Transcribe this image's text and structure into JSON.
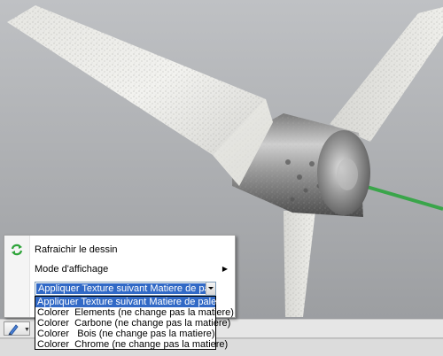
{
  "context_menu": {
    "refresh_label": "Rafraichir le dessin",
    "display_mode_label": "Mode d'affichage",
    "submenu_arrow": "▶"
  },
  "texture_select": {
    "selected": "Appliquer Texture suivant Matiere de pale",
    "options": [
      "Appliquer Texture suivant Matiere de pale",
      "Colorer  Elements (ne change pas la matiere)",
      "Colorer  Carbone (ne change pas la matiere)",
      "Colorer   Bois (ne change pas la matiere)",
      "Colorer  Chrome (ne change pas la matiere)"
    ],
    "highlighted_index": 0
  },
  "icons": {
    "refresh": "refresh-arrows-icon",
    "toolbar_tool": "pencil-icon",
    "dropdown": "chevron-down-icon"
  },
  "colors": {
    "highlight": "#3169c6",
    "background": "#a3a5a8",
    "shaft": "#3aa54a",
    "refresh_icon": "#2fa43a"
  }
}
